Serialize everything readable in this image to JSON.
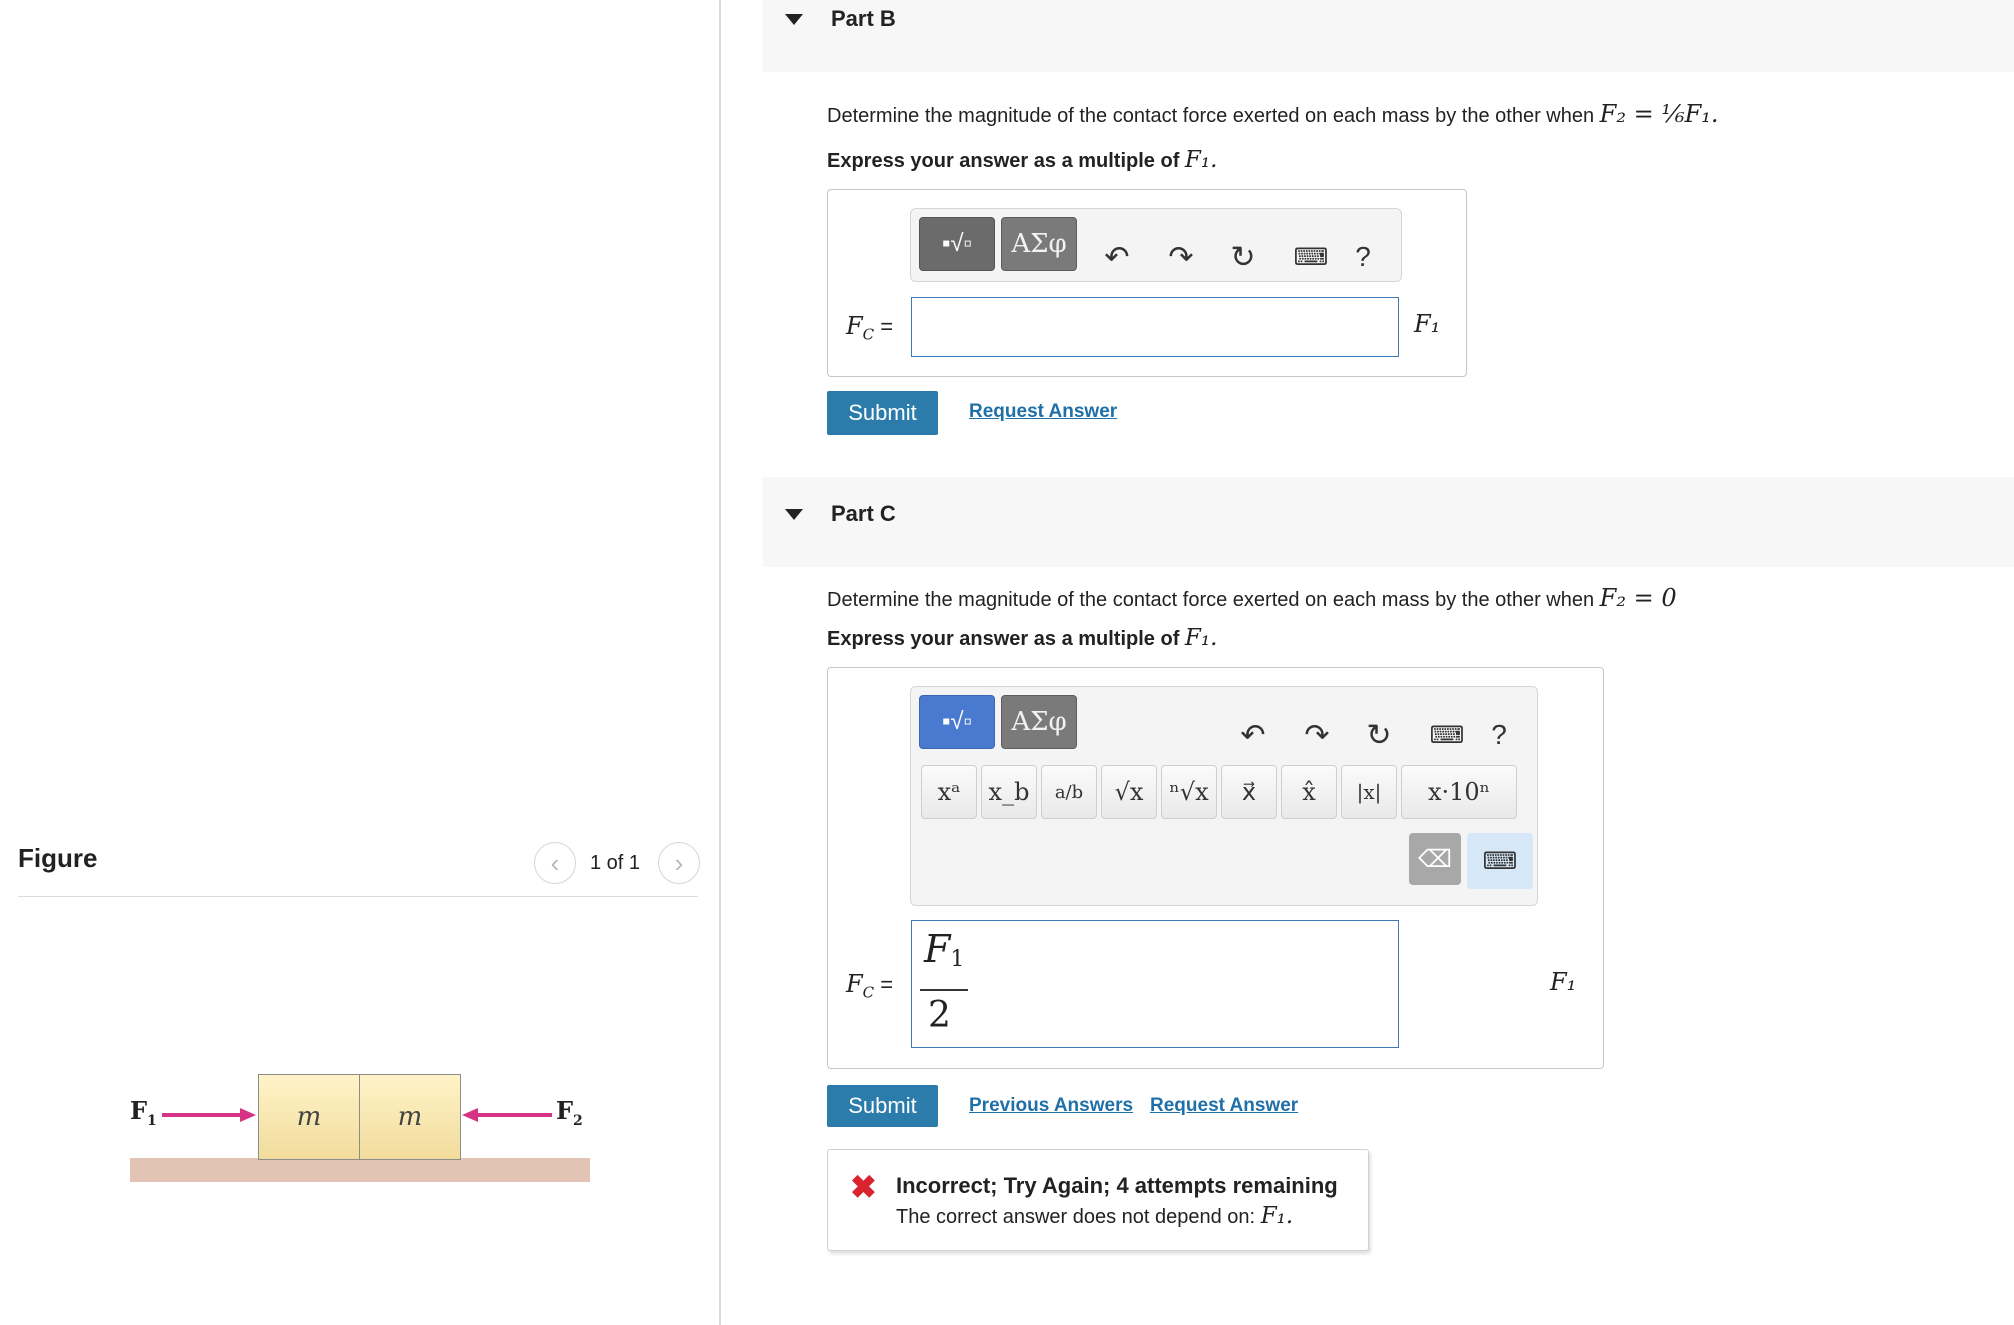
{
  "figure": {
    "title": "Figure",
    "counter": "1 of 1",
    "prev_icon": "chevron-left-icon",
    "next_icon": "chevron-right-icon",
    "left_force_label": "F",
    "left_force_sub": "1",
    "right_force_label": "F",
    "right_force_sub": "2",
    "mass1_label": "m",
    "mass2_label": "m",
    "arrow_color": "#d63384",
    "block_color": "#f5e6b0",
    "ground_color": "#e3c4b4"
  },
  "part_b": {
    "title": "Part B",
    "question_prefix": "Determine the magnitude of the contact force exerted on each mass by the other when",
    "question_math": "F₂ = ⅙F₁.",
    "express_prefix": "Express your answer as a multiple of",
    "express_math": "F₁.",
    "fc_label": "F",
    "fc_sub": "C",
    "fc_eq": "=",
    "input_value": "",
    "unit": "F₁",
    "submit_label": "Submit",
    "request_label": "Request Answer"
  },
  "part_c": {
    "title": "Part C",
    "question_prefix": "Determine the magnitude of the contact force exerted on each mass by the other when",
    "question_math": "F₂ = 0",
    "express_prefix": "Express your answer as a multiple of",
    "express_math": "F₁.",
    "fc_label": "F",
    "fc_sub": "C",
    "fc_eq": "=",
    "input_numerator": "F",
    "input_numerator_sub": "1",
    "input_denominator": "2",
    "unit": "F₁",
    "submit_label": "Submit",
    "previous_label": "Previous Answers",
    "request_label": "Request Answer",
    "math_keys": [
      "xᵃ",
      "x_b",
      "a/b",
      "√x",
      "ⁿ√x",
      "x⃗",
      "x̂",
      "|x|",
      "x·10ⁿ"
    ]
  },
  "toolbar": {
    "greek_label": "ΑΣφ",
    "help_label": "?"
  },
  "feedback": {
    "title": "Incorrect; Try Again; 4 attempts remaining",
    "message_prefix": "The correct answer does not depend on:",
    "message_math": "F₁.",
    "icon_color": "#d9232f"
  }
}
